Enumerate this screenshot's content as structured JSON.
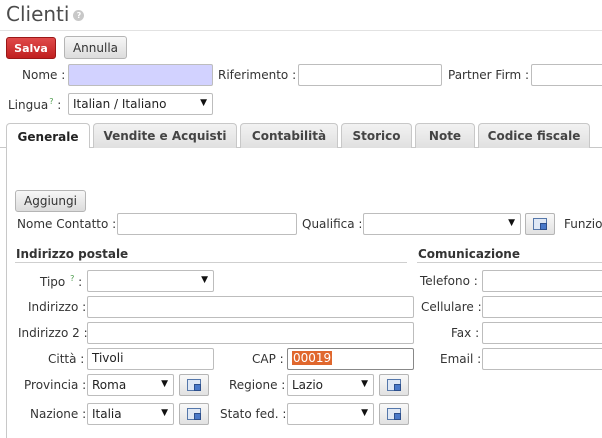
{
  "header": {
    "title": "Clienti",
    "help": "?"
  },
  "toolbar": {
    "save_label": "Salva",
    "cancel_label": "Annulla"
  },
  "top_form": {
    "name_label": "Nome :",
    "ref_label": "Riferimento :",
    "partner_label": "Partner Firm :",
    "lang_label": "Lingua",
    "lang_colon": ":",
    "lang_value": "Italian / Italiano"
  },
  "tabs": [
    {
      "label": "Generale"
    },
    {
      "label": "Vendite e Acquisti"
    },
    {
      "label": "Contabilità"
    },
    {
      "label": "Storico"
    },
    {
      "label": "Note"
    },
    {
      "label": "Codice fiscale"
    }
  ],
  "general": {
    "add_label": "Aggiungi",
    "contact_name_label": "Nome Contatto :",
    "title_label": "Qualifica :",
    "function_label": "Funzio",
    "address_section": "Indirizzo postale",
    "comm_section": "Comunicazione",
    "type_label": "Tipo",
    "type_colon": ":",
    "address_label": "Indirizzo :",
    "address2_label": "Indirizzo 2 :",
    "city_label": "Città :",
    "city_value": "Tivoli",
    "zip_label": "CAP :",
    "zip_value": "00019",
    "province_label": "Provincia :",
    "province_value": "Roma",
    "region_label": "Regione :",
    "region_value": "Lazio",
    "country_label": "Nazione :",
    "country_value": "Italia",
    "state_label": "Stato fed. :",
    "phone_label": "Telefono :",
    "mobile_label": "Cellulare :",
    "fax_label": "Fax :",
    "email_label": "Email :"
  }
}
